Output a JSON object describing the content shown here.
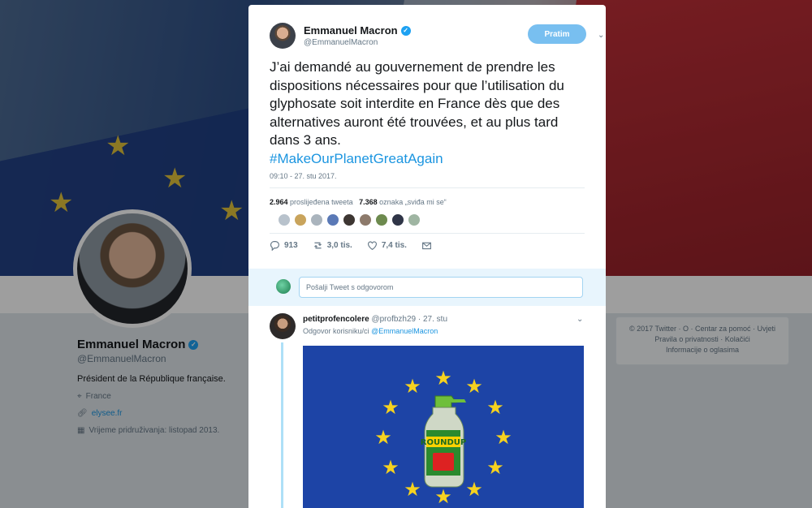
{
  "tweet": {
    "author_name": "Emmanuel Macron",
    "author_handle": "@EmmanuelMacron",
    "follow_label": "Pratim",
    "text": "J’ai demandé au gouvernement de prendre les dispositions nécessaires pour que l’utilisation du glyphosate soit interdite en France dès que des alternatives auront été trouvées, et au plus tard dans 3 ans.",
    "hashtag": "#MakeOurPlanetGreatAgain",
    "timestamp": "09:10 - 27. stu 2017.",
    "retweets_count": "2.964",
    "retweets_label": "proslijeđena tweeta",
    "likes_count": "7.368",
    "likes_label": "oznaka „sviđa mi se“",
    "actions": {
      "replies": "913",
      "retweets": "3,0 tis.",
      "likes": "7,4 tis."
    }
  },
  "reply_box": {
    "placeholder": "Pošalji Tweet s odgovorom"
  },
  "reply": {
    "author_name": "petitprofencolere",
    "author_handle": "@profbzh29",
    "date": "· 27. stu",
    "replying_to_prefix": "Odgovor korisniku/ci",
    "replying_to_handle": "@EmmanuelMacron",
    "media_text": "ROUNDUP"
  },
  "profile": {
    "name": "Emmanuel Macron",
    "handle": "@EmmanuelMacron",
    "bio": "Président de la République française.",
    "location": "France",
    "website": "elysee.fr",
    "joined": "Vrijeme pridruživanja: listopad 2013."
  },
  "footer": {
    "line1": "© 2017 Twitter · O · Centar za pomoć · Uvjeti",
    "line2": "Pravila o privatnosti · Kolačići",
    "line3": "Informacije o oglasima"
  },
  "colors": {
    "accent": "#1da1f2",
    "follow_button": "#78bff0",
    "eu_blue": "#1d44a6",
    "eu_star": "#f6d21f"
  }
}
